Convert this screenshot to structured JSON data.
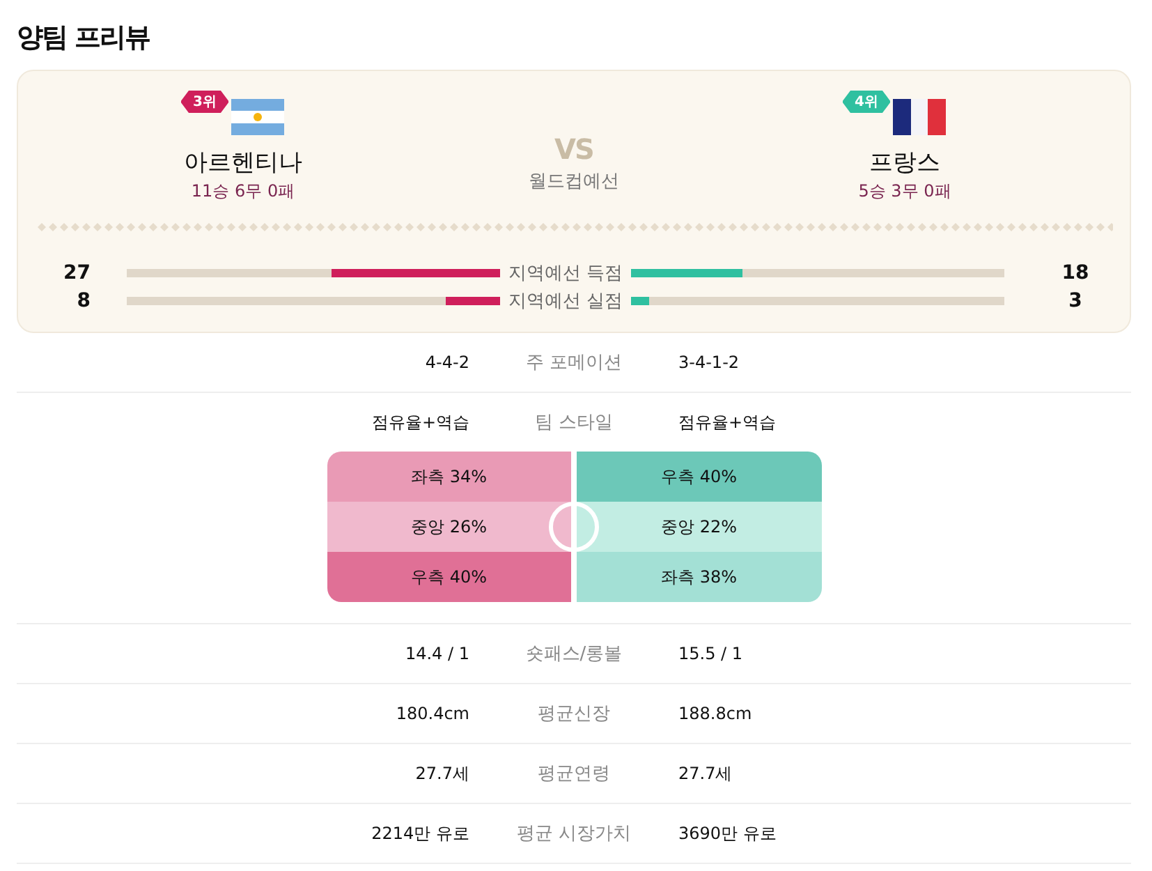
{
  "title": "양팀 프리뷰",
  "match": {
    "vs": "VS",
    "competition": "월드컵예선",
    "teams": [
      {
        "name": "아르헨티나",
        "rank": "3위",
        "record": "11승 6무 0패",
        "kind": "ar"
      },
      {
        "name": "프랑스",
        "rank": "4위",
        "record": "5승 3무 0패",
        "kind": "fr"
      }
    ],
    "stats": [
      {
        "label": "지역예선 득점",
        "home": {
          "value": "27",
          "level": 0.45
        },
        "away": {
          "value": "18",
          "level": 0.3
        }
      },
      {
        "label": "지역예선 실점",
        "home": {
          "value": "8",
          "level": 0.145
        },
        "away": {
          "value": "3",
          "level": 0.05
        }
      }
    ]
  },
  "rows": [
    {
      "kind": "text",
      "label": "주 포메이션",
      "home": "4-4-2",
      "away": "3-4-1-2"
    },
    {
      "kind": "style",
      "label": "팀 스타일",
      "home": "점유율+역습",
      "away": "점유율+역습",
      "field": {
        "home": [
          {
            "text": "좌측 34%",
            "color": "#e99ab5"
          },
          {
            "text": "중앙 26%",
            "color": "#f0b9cd"
          },
          {
            "text": "우측 40%",
            "color": "#e07096"
          }
        ],
        "away": [
          {
            "text": "우측 40%",
            "color": "#6cc8b8"
          },
          {
            "text": "중앙 22%",
            "color": "#c2ede3"
          },
          {
            "text": "좌측 38%",
            "color": "#a3e0d5"
          }
        ]
      }
    },
    {
      "kind": "text",
      "label": "숏패스/롱볼",
      "home": "14.4 / 1",
      "away": "15.5 / 1"
    },
    {
      "kind": "text",
      "label": "평균신장",
      "home": "180.4cm",
      "away": "188.8cm"
    },
    {
      "kind": "text",
      "label": "평균연령",
      "home": "27.7세",
      "away": "27.7세"
    },
    {
      "kind": "text",
      "label": "평균 시장가치",
      "home": "2214만 유로",
      "away": "3690만 유로"
    }
  ]
}
